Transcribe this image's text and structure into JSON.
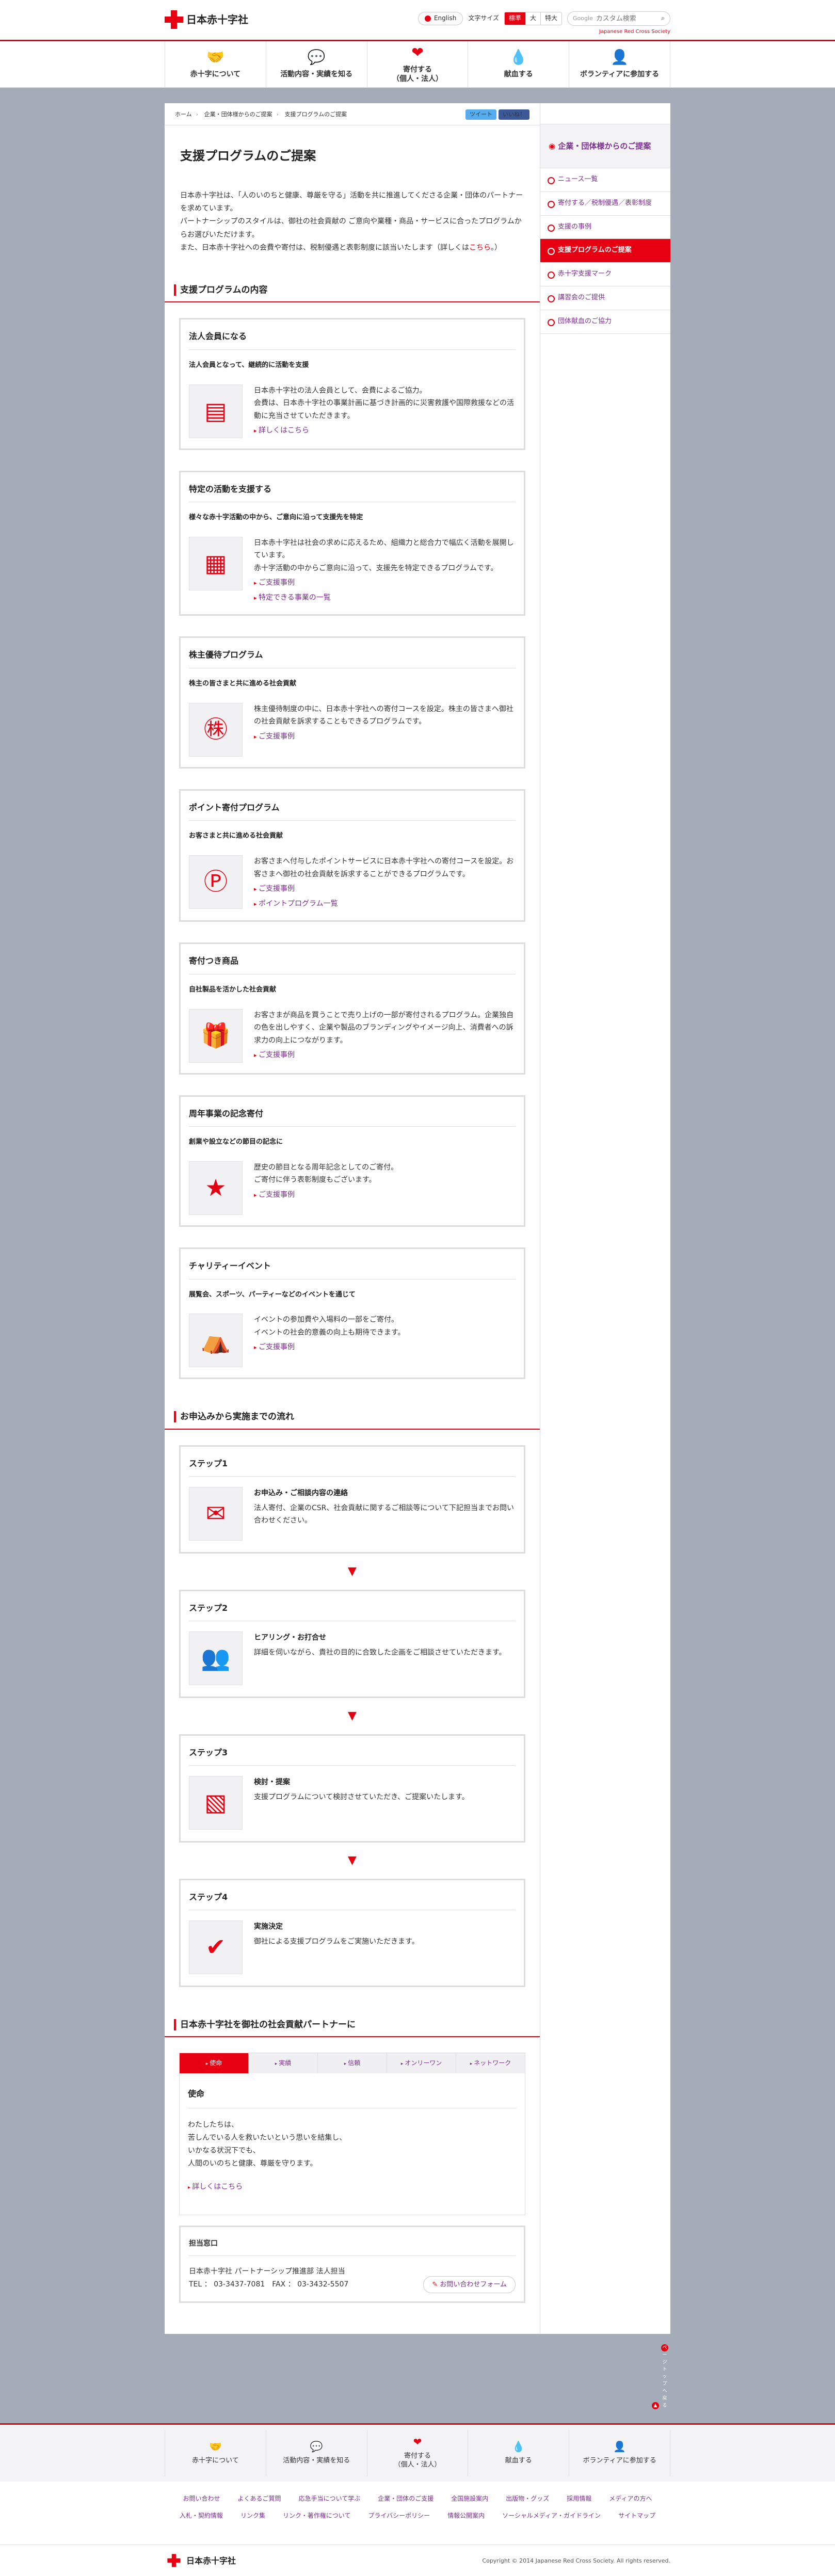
{
  "header": {
    "logo": "日本赤十字社",
    "english": "English",
    "fontsize_label": "文字サイズ",
    "fontsizes": [
      "標準",
      "大",
      "特大"
    ],
    "search_brand": "Google",
    "search_placeholder": "カスタム検索",
    "jrc": "Japanese Red Cross Society"
  },
  "gnav": [
    {
      "label": "赤十字について",
      "icon": "handshake-icon"
    },
    {
      "label": "活動内容・実績を知る",
      "icon": "speech-icon"
    },
    {
      "label": "寄付する\n（個人・法人）",
      "icon": "heart-icon"
    },
    {
      "label": "献血する",
      "icon": "drop-icon"
    },
    {
      "label": "ボランティアに参加する",
      "icon": "person-icon"
    }
  ],
  "breadcrumb": [
    "ホーム",
    "企業・団体様からのご提案",
    "支援プログラムのご提案"
  ],
  "sns": {
    "tweet": "ツイート",
    "like": "いいね！"
  },
  "page_title": "支援プログラムのご提案",
  "intro": {
    "p1": "日本赤十字社は、「人のいのちと健康、尊厳を守る」活動を共に推進してくださる企業・団体のパートナーを求めています。",
    "p2": "パートナーシップのスタイルは、御社の社会貢献の ご意向や業種・商品・サービスに合ったプログラムからお選びいただけます。",
    "p3": "また、日本赤十字社への会費や寄付は、税制優遇と表彰制度に該当いたします（詳しくは",
    "p3_link": "こちら",
    "p3_end": "。）"
  },
  "programs_title": "支援プログラムの内容",
  "programs": [
    {
      "title": "法人会員になる",
      "sub": "法人会員となって、継続的に活動を支援",
      "text": "日本赤十字社の法人会員として、会費によるご協力。\n会費は、日本赤十字社の事業計画に基づき計画的に災害救護や国際救援などの活動に充当させていただきます。",
      "links": [
        "詳しくはこちら"
      ],
      "icon": "id-card-icon",
      "glyph": "▤"
    },
    {
      "title": "特定の活動を支援する",
      "sub": "様々な赤十字活動の中から、ご意向に沿って支援先を特定",
      "text": "日本赤十字社は社会の求めに応えるため、組織力と総合力で幅広く活動を展開しています。\n赤十字活動の中からご意向に沿って、支援先を特定できるプログラムです。",
      "links": [
        "ご支援事例",
        "特定できる事業の一覧"
      ],
      "icon": "presentation-icon",
      "glyph": "▦"
    },
    {
      "title": "株主優待プログラム",
      "sub": "株主の皆さまと共に進める社会貢献",
      "text": "株主優待制度の中に、日本赤十字社への寄付コースを設定。株主の皆さまへ御社の社会貢献を訴求することもできるプログラムです。",
      "links": [
        "ご支援事例"
      ],
      "icon": "kabu-icon",
      "glyph": "㊑"
    },
    {
      "title": "ポイント寄付プログラム",
      "sub": "お客さまと共に進める社会貢献",
      "text": "お客さまへ付与したポイントサービスに日本赤十字社への寄付コースを設定。お客さまへ御社の社会貢献を訴求することができるプログラムです。",
      "links": [
        "ご支援事例",
        "ポイントプログラム一覧"
      ],
      "icon": "point-icon",
      "glyph": "Ⓟ"
    },
    {
      "title": "寄付つき商品",
      "sub": "自社製品を活かした社会貢献",
      "text": "お客さまが商品を買うことで売り上げの一部が寄付されるプログラム。企業独自の色を出しやすく、企業や製品のブランディングやイメージ向上、消費者への訴求力の向上につながります。",
      "links": [
        "ご支援事例"
      ],
      "icon": "gift-icon",
      "glyph": "🎁"
    },
    {
      "title": "周年事業の記念寄付",
      "sub": "創業や設立などの節目の記念に",
      "text": "歴史の節目となる周年記念としてのご寄付。\nご寄付に伴う表彰制度もございます。",
      "links": [
        "ご支援事例"
      ],
      "icon": "laurel-star-icon",
      "glyph": "★"
    },
    {
      "title": "チャリティーイベント",
      "sub": "展覧会、スポーツ、パーティーなどのイベントを通じて",
      "text": "イベントの参加費や入場料の一部をご寄付。\nイベントの社会的意義の向上も期待できます。",
      "links": [
        "ご支援事例"
      ],
      "icon": "tent-icon",
      "glyph": "⛺"
    }
  ],
  "flow_title": "お申込みから実施までの流れ",
  "steps": [
    {
      "title": "ステップ1",
      "head": "お申込み・ご相談内容の連絡",
      "text": "法人寄付、企業のCSR、社会貢献に関するご相談等について下記担当までお問い合わせください。",
      "icon": "phone-mail-icon",
      "glyph": "✉"
    },
    {
      "title": "ステップ2",
      "head": "ヒアリング・お打合せ",
      "text": "詳細を伺いながら、貴社の目的に合致した企画をご相談させていただきます。",
      "icon": "meeting-icon",
      "glyph": "👥"
    },
    {
      "title": "ステップ3",
      "head": "検討・提案",
      "text": "支援プログラムについて検討させていただき、ご提案いたします。",
      "icon": "proposal-icon",
      "glyph": "▧"
    },
    {
      "title": "ステップ4",
      "head": "実施決定",
      "text": "御社による支援プログラムをご実施いただきます。",
      "icon": "check-icon",
      "glyph": "✔"
    }
  ],
  "partner_title": "日本赤十字社を御社の社会貢献パートナーに",
  "tabs": [
    "使命",
    "実績",
    "信頼",
    "オンリーワン",
    "ネットワーク"
  ],
  "mission": {
    "title": "使命",
    "lines": [
      "わたしたちは、",
      "苦しんでいる人を救いたいという思いを結集し、",
      "いかなる状況下でも、",
      "人間のいのちと健康、尊厳を守ります。"
    ],
    "link": "詳しくはこちら"
  },
  "contact": {
    "title": "担当窓口",
    "org": "日本赤十字社 パートナーシップ推進部 法人担当",
    "tel": "TEL ： 03-3437-7081　FAX ： 03-3432-5507",
    "form": "お問い合わせフォーム"
  },
  "side": {
    "title": "企業・団体様からのご提案",
    "items": [
      "ニュース一覧",
      "寄付する／税制優遇／表彰制度",
      "支援の事例",
      "支援プログラムのご提案",
      "赤十字支援マーク",
      "講習会のご提供",
      "団体献血のご協力"
    ],
    "active": 3
  },
  "pagetop": "ページトップへ戻る",
  "footer": {
    "nav": [
      "赤十字について",
      "活動内容・実績を知る",
      "寄付する\n（個人・法人）",
      "献血する",
      "ボランティアに参加する"
    ],
    "row1": [
      "お問い合わせ",
      "よくあるご質問",
      "応急手当について学ぶ",
      "企業・団体のご支援",
      "全国施設案内",
      "出版物・グッズ",
      "採用情報",
      "メディアの方へ"
    ],
    "row2": [
      "入札・契約情報",
      "リンク集",
      "リンク・著作権について",
      "プライバシーポリシー",
      "情報公開案内",
      "ソーシャルメディア・ガイドライン",
      "サイトマップ"
    ],
    "copyright": "Copyright © 2014 Japanese Red Cross Society. All rights reserved."
  }
}
